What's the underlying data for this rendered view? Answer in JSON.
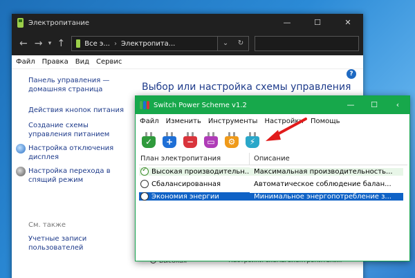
{
  "control_panel": {
    "title": "Электропитание",
    "address": {
      "part1": "Все э...",
      "part2": "Электропита..."
    },
    "menu": [
      "Файл",
      "Правка",
      "Вид",
      "Сервис"
    ],
    "sidebar": {
      "home": "Панель управления — домашняя страница",
      "links": [
        "Действия кнопок питания",
        "Создание схемы управления питанием",
        "Настройка отключения дисплея",
        "Настройка перехода в спящий режим"
      ],
      "see_also": "См. также",
      "accounts": "Учетные записи пользователей"
    },
    "heading": "Выбор или настройка схемы управления",
    "bottom_plan": "Высокая",
    "bottom_desc": "Настройки схемы электропитания"
  },
  "sps": {
    "title": "Switch Power Scheme v1.2",
    "menu": [
      "Файл",
      "Изменить",
      "Инструменты",
      "Настройки",
      "Помощь"
    ],
    "toolbar_colors": [
      "#2f9a3c",
      "#1e6fd6",
      "#d9343c",
      "#b03cb8",
      "#ef9a1a",
      "#2aa7c9"
    ],
    "columns": [
      "План электропитания",
      "Описание"
    ],
    "rows": [
      {
        "name": "Высокая производительн...",
        "desc": "Максимальная производительность...",
        "state": "active"
      },
      {
        "name": "Сбалансированная",
        "desc": "Автоматическое соблюдение балан...",
        "state": ""
      },
      {
        "name": "Экономия энергии",
        "desc": "Минимальное энергопотребление з...",
        "state": "selected"
      }
    ]
  }
}
